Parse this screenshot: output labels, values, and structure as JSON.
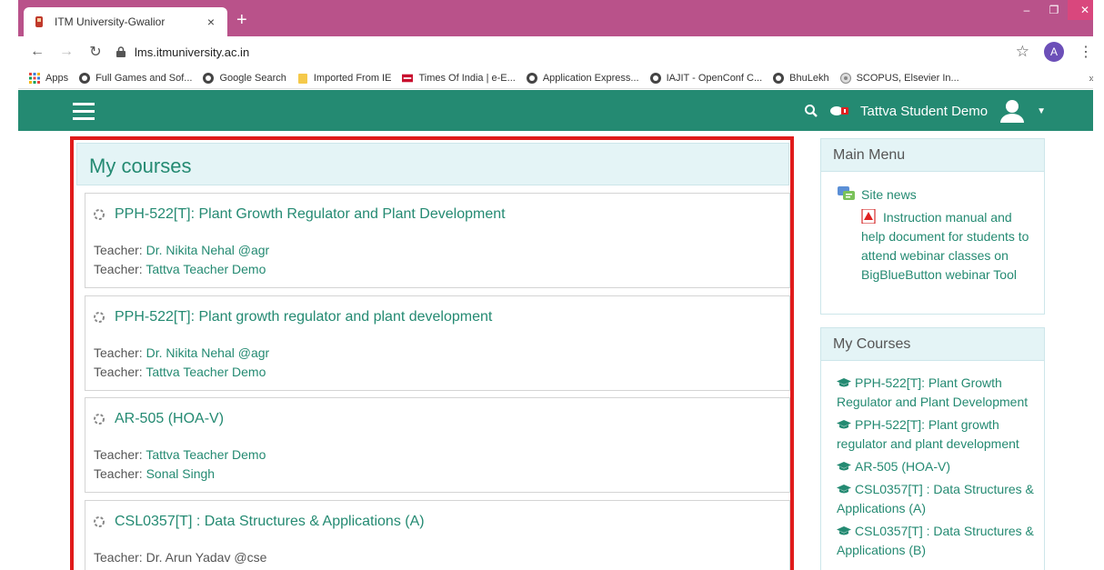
{
  "browser": {
    "tab_title": "ITM University-Gwalior",
    "tab_close": "×",
    "new_tab": "+",
    "url": "lms.itmuniversity.ac.in",
    "account_initial": "A",
    "window_controls": {
      "minimize": "–",
      "maximize": "❐",
      "close": "✕"
    }
  },
  "bookmarks": [
    {
      "label": "Apps",
      "icon": "apps-grid-icon"
    },
    {
      "label": "Full Games and Sof...",
      "icon": "globe-icon"
    },
    {
      "label": "Google Search",
      "icon": "globe-icon"
    },
    {
      "label": "Imported From IE",
      "icon": "folder-icon"
    },
    {
      "label": "Times Of India | e-E...",
      "icon": "toi-icon"
    },
    {
      "label": "Application Express...",
      "icon": "globe-icon"
    },
    {
      "label": "IAJIT - OpenConf C...",
      "icon": "globe-icon"
    },
    {
      "label": "BhuLekh",
      "icon": "globe-icon"
    },
    {
      "label": "SCOPUS, Elsevier In...",
      "icon": "scopus-icon"
    }
  ],
  "bookmarks_more": "»",
  "sitenav": {
    "user_name": "Tattva Student Demo",
    "caret": "▼",
    "color": "#248a72"
  },
  "my_courses": {
    "title": "My courses",
    "courses": [
      {
        "title": "PPH-522[T]: Plant Growth Regulator and Plant Development",
        "teacher1_label": "Teacher: ",
        "teacher1": "Dr. Nikita Nehal @agr",
        "teacher2_label": "Teacher: ",
        "teacher2": "Tattva Teacher Demo"
      },
      {
        "title": "PPH-522[T]: Plant growth regulator and plant development",
        "teacher1_label": "Teacher: ",
        "teacher1": "Dr. Nikita Nehal @agr",
        "teacher2_label": "Teacher: ",
        "teacher2": "Tattva Teacher Demo"
      },
      {
        "title": "AR-505 (HOA-V)",
        "teacher1_label": "Teacher: ",
        "teacher1": "Tattva Teacher Demo",
        "teacher2_label": "Teacher: ",
        "teacher2": "Sonal Singh"
      },
      {
        "title": "CSL0357[T] : Data Structures & Applications (A)",
        "teacher1_label": "Teacher: ",
        "teacher1": "Dr. Arun Yadav @cse",
        "teacher2_label": "",
        "teacher2": ""
      }
    ]
  },
  "main_menu": {
    "title": "Main Menu",
    "site_news": "Site news",
    "instruction": "Instruction manual and help document for students to attend webinar classes on BigBlueButton webinar Tool"
  },
  "side_courses": {
    "title": "My Courses",
    "items": [
      "PPH-522[T]: Plant Growth Regulator and Plant Development",
      "PPH-522[T]: Plant growth regulator and plant development",
      "AR-505 (HOA-V)",
      "CSL0357[T] : Data Structures & Applications (A)",
      "CSL0357[T] : Data Structures & Applications (B)"
    ]
  }
}
